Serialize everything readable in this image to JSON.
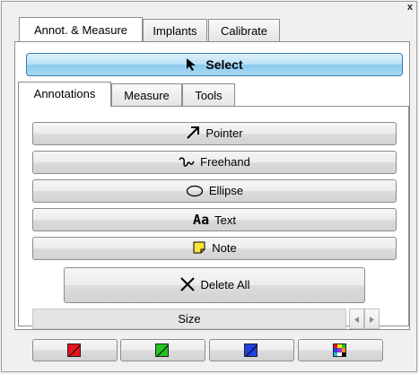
{
  "window": {
    "close_label": "x"
  },
  "main_tabs": [
    {
      "label": "Annot. & Measure",
      "active": true
    },
    {
      "label": "Implants",
      "active": false
    },
    {
      "label": "Calibrate",
      "active": false
    }
  ],
  "select_button": {
    "label": "Select",
    "icon": "cursor-arrow-icon"
  },
  "sub_tabs": [
    {
      "label": "Annotations",
      "active": true
    },
    {
      "label": "Measure",
      "active": false
    },
    {
      "label": "Tools",
      "active": false
    }
  ],
  "tools": {
    "pointer": {
      "label": "Pointer",
      "icon": "arrow-pointer-icon"
    },
    "freehand": {
      "label": "Freehand",
      "icon": "freehand-squiggle-icon"
    },
    "ellipse": {
      "label": "Ellipse",
      "icon": "ellipse-icon"
    },
    "text": {
      "label": "Text",
      "icon_text": "Aa",
      "icon": "text-aa-icon"
    },
    "note": {
      "label": "Note",
      "icon": "sticky-note-icon"
    }
  },
  "delete_all": {
    "label": "Delete All",
    "icon": "x-cross-icon"
  },
  "size": {
    "label": "Size"
  },
  "colors": {
    "red": "#e8141c",
    "green": "#22c41e",
    "blue": "#2140e0",
    "palette": [
      "#e8141c",
      "#f5e400",
      "#22c41e",
      "#2140e0",
      "#9a2fd0",
      "#f08a1c",
      "#1fbfd6",
      "#ffffff",
      "#000000"
    ]
  }
}
